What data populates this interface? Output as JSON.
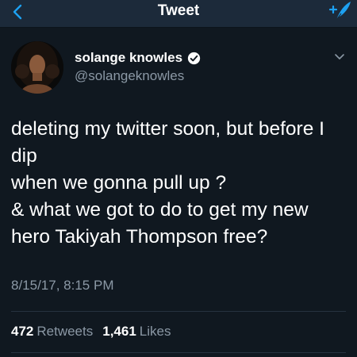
{
  "nav": {
    "title": "Tweet",
    "back_icon": "chevron-left-icon",
    "compose_icon": "compose-tweet-icon",
    "accent_color": "#1da1f2"
  },
  "tweet": {
    "author_name": "solange knowles",
    "author_handle": "@solangeknowles",
    "verified": true,
    "text": "deleting my twitter soon, but before I\ndip\nwhen we gonna pull up ?\n& what we got to do to get my new\nhero Takiyah Thompson free?",
    "timestamp": "8/15/17, 8:15 PM",
    "retweets_count": "472",
    "retweets_label": "Retweets",
    "likes_count": "1,461",
    "likes_label": "Likes"
  }
}
